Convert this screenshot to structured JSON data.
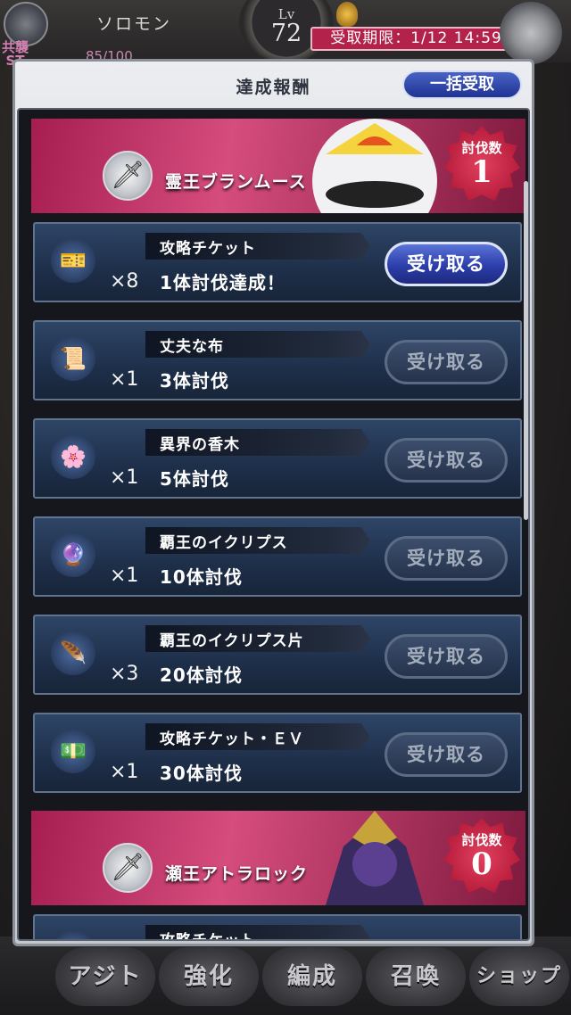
{
  "hud": {
    "player_name": "ソロモン",
    "level_label": "Lv",
    "level_value": "72",
    "deadline": "受取期限：1/12 14:59",
    "st_label": "共襲\nST",
    "st_value": "85/100"
  },
  "modal": {
    "title": "達成報酬",
    "bulk_claim_label": "一括受取"
  },
  "bosses": [
    {
      "name": "霊王ブランムース",
      "kill_label": "討伐数",
      "kill_value": "1",
      "rewards": [
        {
          "icon": "attack-ticket-icon",
          "glyph": "🎫",
          "name": "攻略チケット",
          "qty": "×8",
          "condition": "1体討伐達成！",
          "claim_label": "受け取る",
          "claimable": true
        },
        {
          "icon": "cloth-icon",
          "glyph": "📜",
          "name": "丈夫な布",
          "qty": "×1",
          "condition": "3体討伐",
          "claim_label": "受け取る",
          "claimable": false
        },
        {
          "icon": "incense-wood-icon",
          "glyph": "🌸",
          "name": "異界の香木",
          "qty": "×1",
          "condition": "5体討伐",
          "claim_label": "受け取る",
          "claimable": false
        },
        {
          "icon": "eclipse-icon",
          "glyph": "🔮",
          "name": "覇王のイクリプス",
          "qty": "×1",
          "condition": "10体討伐",
          "claim_label": "受け取る",
          "claimable": false
        },
        {
          "icon": "eclipse-shard-icon",
          "glyph": "🪶",
          "name": "覇王のイクリプス片",
          "qty": "×3",
          "condition": "20体討伐",
          "claim_label": "受け取る",
          "claimable": false
        },
        {
          "icon": "attack-ticket-ev-icon",
          "glyph": "💵",
          "name": "攻略チケット・ＥＶ",
          "qty": "×1",
          "condition": "30体討伐",
          "claim_label": "受け取る",
          "claimable": false
        }
      ]
    },
    {
      "name": "瀬王アトラロック",
      "kill_label": "討伐数",
      "kill_value": "0",
      "rewards": [
        {
          "icon": "attack-ticket-icon",
          "glyph": "🎫",
          "name": "攻略チケット"
        }
      ]
    }
  ],
  "nav": [
    "アジト",
    "強化",
    "編成",
    "召喚",
    "ショップ"
  ],
  "colors": {
    "banner": "#c43a6a",
    "row": "#22344f",
    "active_button": "#3348b8",
    "deadline_bg": "#b3224b"
  }
}
